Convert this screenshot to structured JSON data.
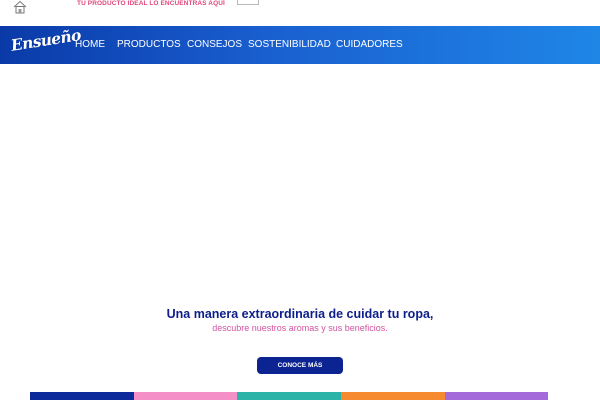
{
  "topbar": {
    "icon": "house-icon",
    "promo_text": "TU PRODUCTO IDEAL LO ENCUENTRAS AQUÍ"
  },
  "brand": {
    "logo_text": "Ensueño",
    "gradient": [
      "#0a3aa8",
      "#1f86e6"
    ]
  },
  "nav": {
    "items": [
      "HOME",
      "PRODUCTOS",
      "CONSEJOS",
      "SOSTENIBILIDAD",
      "CUIDADORES"
    ]
  },
  "hero": {
    "title": "Una manera extraordinaria de cuidar tu ropa,",
    "subtitle": "descubre nuestros aromas y sus beneficios.",
    "cta_label": "CONOCE MÁS"
  },
  "colors": {
    "title": "#0c1e8c",
    "subtitle": "#d2549f",
    "cta": "#0b2491",
    "strip": [
      "#0d2a9a",
      "#f48fc8",
      "#2ab3a6",
      "#f68a2e",
      "#a56ad9"
    ]
  }
}
